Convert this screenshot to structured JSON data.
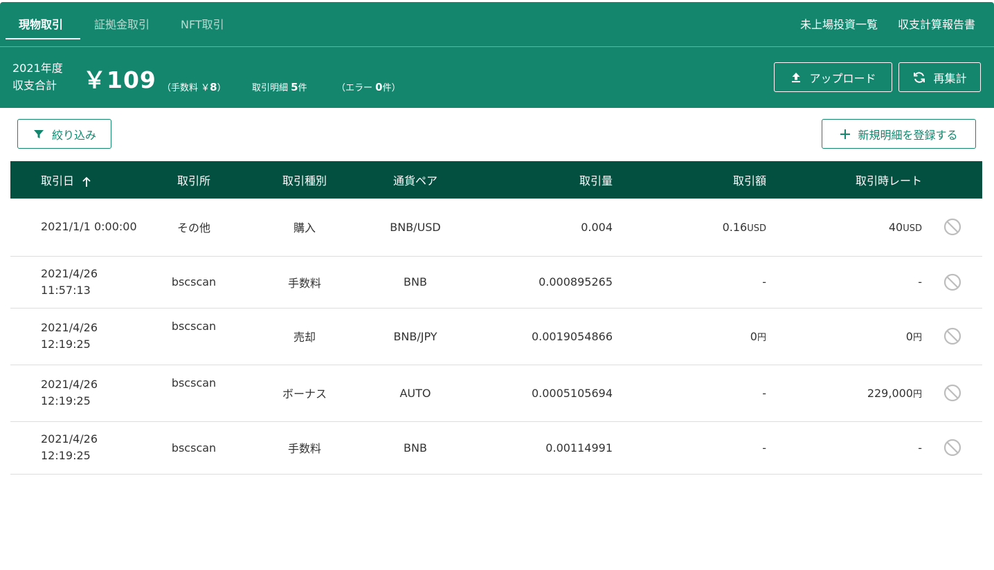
{
  "tabs": [
    {
      "label": "現物取引",
      "active": true
    },
    {
      "label": "証拠金取引",
      "active": false
    },
    {
      "label": "NFT取引",
      "active": false
    }
  ],
  "toplinks": {
    "unlisted": "未上場投資一覧",
    "report": "収支計算報告書"
  },
  "summary": {
    "year": "2021年度",
    "label": "収支合計",
    "total": "￥109",
    "fee_prefix": "（手数料 ￥",
    "fee_value": "8",
    "fee_suffix": "）",
    "details_prefix": "取引明細",
    "details_count": "5",
    "details_suffix": "件",
    "error_prefix": "（エラー",
    "error_count": "0",
    "error_suffix": "件）"
  },
  "buttons": {
    "upload": "アップロード",
    "recalc": "再集計",
    "filter": "絞り込み",
    "add": "新規明細を登録する"
  },
  "table": {
    "headers": {
      "date": "取引日",
      "exchange": "取引所",
      "type": "取引種別",
      "pair": "通貨ペア",
      "qty": "取引量",
      "amount": "取引額",
      "rate": "取引時レート"
    },
    "rows": [
      {
        "date": "2021/1/1 0:00:00",
        "time": "",
        "exchange": "その他",
        "type": "購入",
        "pair": "BNB/USD",
        "qty": "0.004",
        "amount": "0.16",
        "amount_unit": "USD",
        "rate": "40",
        "rate_unit": "USD"
      },
      {
        "date": "2021/4/26",
        "time": "11:57:13",
        "exchange": "bscscan",
        "type": "手数料",
        "pair": "BNB",
        "qty": "0.000895265",
        "amount": "-",
        "amount_unit": "",
        "rate": "-",
        "rate_unit": ""
      },
      {
        "date": "2021/4/26",
        "time": "12:19:25",
        "exchange": "bscscan",
        "type": "売却",
        "pair": "BNB/JPY",
        "qty": "0.0019054866",
        "amount": "0",
        "amount_unit": "円",
        "rate": "0",
        "rate_unit": "円"
      },
      {
        "date": "2021/4/26",
        "time": "12:19:25",
        "exchange": "bscscan",
        "type": "ボーナス",
        "pair": "AUTO",
        "qty": "0.0005105694",
        "amount": "-",
        "amount_unit": "",
        "rate": "229,000",
        "rate_unit": "円"
      },
      {
        "date": "2021/4/26",
        "time": "12:19:25",
        "exchange": "bscscan",
        "type": "手数料",
        "pair": "BNB",
        "qty": "0.00114991",
        "amount": "-",
        "amount_unit": "",
        "rate": "-",
        "rate_unit": ""
      }
    ]
  },
  "colors": {
    "primary": "#14866d",
    "header": "#034f40",
    "icon_gray": "#bdbdbd"
  }
}
